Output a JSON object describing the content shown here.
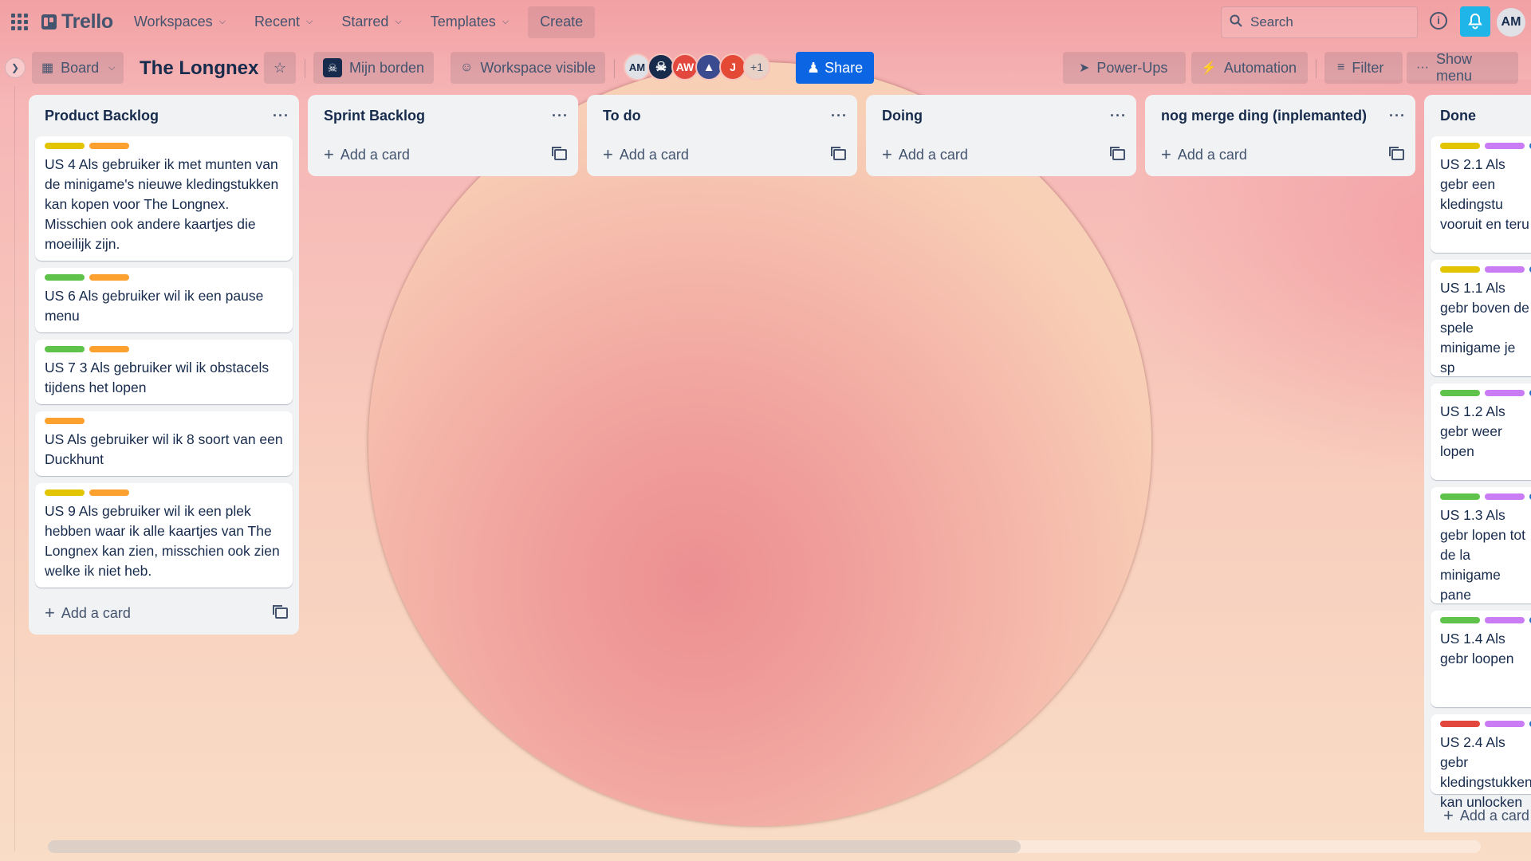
{
  "header": {
    "logo": "Trello",
    "nav": [
      "Workspaces",
      "Recent",
      "Starred",
      "Templates"
    ],
    "create": "Create",
    "search_placeholder": "Search",
    "info": "i",
    "me_initials": "AM"
  },
  "boardbar": {
    "view": "Board",
    "title": "The Longnex",
    "workspace": "Mijn borden",
    "visibility": "Workspace visible",
    "members": [
      {
        "initials": "AM",
        "color": "#dfe1e6",
        "text_color": "#172b4d"
      },
      {
        "initials": "",
        "color": "#172b4d",
        "icon": "skull-avatar"
      },
      {
        "initials": "AW",
        "color": "#e2483d",
        "text_color": "#ffffff"
      },
      {
        "initials": "",
        "color": "#3a4c8f",
        "icon": "triangle-avatar"
      },
      {
        "initials": "J",
        "color": "#e34935",
        "text_color": "#ffffff"
      }
    ],
    "members_more": "+1",
    "share": "Share",
    "powerups": "Power-Ups",
    "automation": "Automation",
    "filter": "Filter",
    "show_menu": "Show menu"
  },
  "colors": {
    "yellow": "#e2c500",
    "orange": "#fca130",
    "green": "#5fc24a",
    "purple": "#c97cf4",
    "red": "#e2483d",
    "blue": "#1f70ca"
  },
  "lists": [
    {
      "title": "Product Backlog",
      "add": "Add a card",
      "cards": [
        {
          "labels": [
            "yellow",
            "orange"
          ],
          "text": "US 4 Als gebruiker ik met munten van de minigame's nieuwe kledingstukken kan kopen voor The Longnex. Misschien ook andere kaartjes die moeilijk zijn."
        },
        {
          "labels": [
            "green",
            "orange"
          ],
          "text": "US 6 Als gebruiker wil ik een pause menu"
        },
        {
          "labels": [
            "green",
            "orange"
          ],
          "text": "US 7 3 Als gebruiker wil ik obstacels tijdens het lopen"
        },
        {
          "labels": [
            "orange"
          ],
          "text": "US Als gebruiker wil ik 8 soort van een Duckhunt"
        },
        {
          "labels": [
            "yellow",
            "orange"
          ],
          "text": "US 9 Als gebruiker wil ik een plek hebben waar ik alle kaartjes van The Longnex kan zien, misschien ook zien welke ik niet heb."
        }
      ]
    },
    {
      "title": "Sprint Backlog",
      "add": "Add a card",
      "cards": []
    },
    {
      "title": "To do",
      "add": "Add a card",
      "cards": []
    },
    {
      "title": "Doing",
      "add": "Add a card",
      "cards": []
    },
    {
      "title": "nog merge ding (inplemanted)",
      "add": "Add a card",
      "cards": []
    },
    {
      "title": "Done",
      "add": "Add a card",
      "cards": [
        {
          "labels": [
            "yellow",
            "purple",
            "blue"
          ],
          "text": "US 2.1 Als gebr een kledingstu vooruit en teru"
        },
        {
          "labels": [
            "yellow",
            "purple",
            "blue"
          ],
          "text": "US 1.1 Als gebr boven de spele minigame je sp"
        },
        {
          "labels": [
            "green",
            "purple",
            "blue"
          ],
          "text": "US 1.2 Als gebr weer lopen"
        },
        {
          "labels": [
            "green",
            "purple",
            "blue"
          ],
          "text": "US 1.3 Als gebr lopen tot de la minigame pane"
        },
        {
          "labels": [
            "green",
            "purple",
            "blue"
          ],
          "text": "US 1.4 Als gebr loopen"
        },
        {
          "labels": [
            "red",
            "purple",
            "blue"
          ],
          "text": "US 2.4 Als gebr kledingstukken kan unlocken"
        }
      ]
    }
  ]
}
